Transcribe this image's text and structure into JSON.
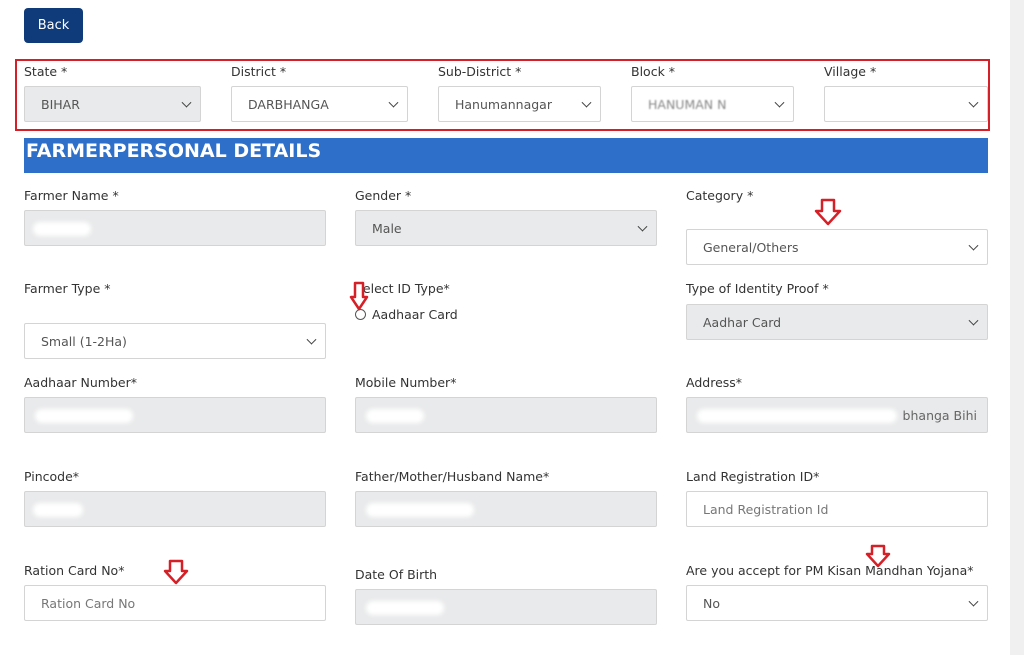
{
  "back_label": "Back",
  "location": {
    "state": {
      "label": "State *",
      "value": "BIHAR"
    },
    "district": {
      "label": "District *",
      "value": "DARBHANGA"
    },
    "sub_district": {
      "label": "Sub-District *",
      "value": "Hanumannagar"
    },
    "block": {
      "label": "Block *",
      "value": "HANUMAN N"
    },
    "village": {
      "label": "Village *",
      "value": ""
    }
  },
  "section_title": "FARMERPERSONAL DETAILS",
  "form": {
    "farmer_name": {
      "label": "Farmer Name *"
    },
    "gender": {
      "label": "Gender *",
      "value": "Male"
    },
    "category": {
      "label": "Category *",
      "value": "General/Others"
    },
    "farmer_type": {
      "label": "Farmer Type *",
      "value": "Small (1-2Ha)"
    },
    "id_type": {
      "label": "Select ID Type*",
      "option": "Aadhaar Card"
    },
    "identity_proof": {
      "label": "Type of Identity Proof *",
      "value": "Aadhar Card"
    },
    "aadhaar_number": {
      "label": "Aadhaar Number*"
    },
    "mobile_number": {
      "label": "Mobile Number*"
    },
    "address": {
      "label": "Address*",
      "visible_tail": "bhanga Bihi"
    },
    "pincode": {
      "label": "Pincode*"
    },
    "guardian_name": {
      "label": "Father/Mother/Husband Name*"
    },
    "land_registration": {
      "label": "Land Registration ID*",
      "placeholder": "Land Registration Id"
    },
    "ration_card": {
      "label": "Ration Card No*",
      "placeholder": "Ration Card No"
    },
    "dob": {
      "label": "Date Of Birth"
    },
    "pm_kisan": {
      "label": "Are you accept for PM Kisan Mandhan Yojana*",
      "value": "No"
    }
  },
  "colors": {
    "header_blue": "#2e6fc9",
    "back_button": "#0f3b7a",
    "highlight_red": "#d62027"
  },
  "annotations": [
    "red-arrow-icon",
    "red-highlight-box"
  ]
}
